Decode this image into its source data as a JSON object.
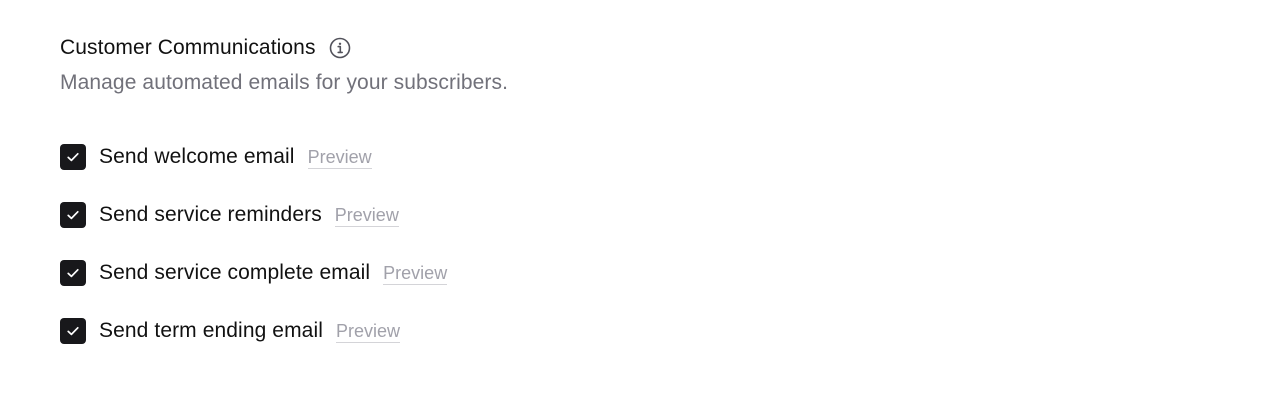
{
  "section": {
    "title": "Customer Communications",
    "info_icon": "info-icon",
    "subtitle": "Manage automated emails for your subscribers."
  },
  "options": [
    {
      "label": "Send welcome email",
      "checked": true,
      "preview_label": "Preview"
    },
    {
      "label": "Send service reminders",
      "checked": true,
      "preview_label": "Preview"
    },
    {
      "label": "Send service complete email",
      "checked": true,
      "preview_label": "Preview"
    },
    {
      "label": "Send term ending email",
      "checked": true,
      "preview_label": "Preview"
    }
  ],
  "colors": {
    "checkbox_fill": "#18181b",
    "subtitle": "#71717a",
    "preview_link": "#a1a1aa"
  }
}
